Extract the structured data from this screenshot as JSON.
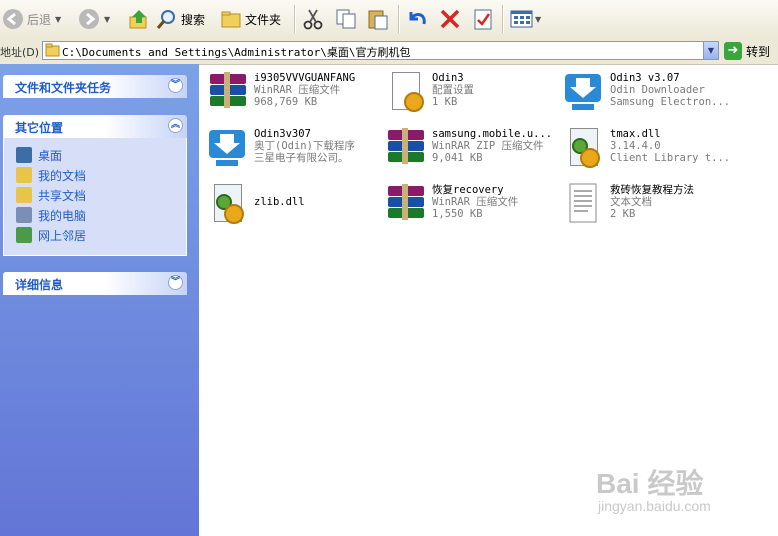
{
  "toolbar": {
    "back_label": "后退",
    "search_label": "搜索",
    "folders_label": "文件夹"
  },
  "address": {
    "label": "地址(D)",
    "path": "C:\\Documents and Settings\\Administrator\\桌面\\官方刷机包",
    "go_label": "转到"
  },
  "left_pane": {
    "tasks_title": "文件和文件夹任务",
    "other_places_title": "其它位置",
    "other_places": [
      {
        "label": "桌面",
        "icon": "desktop-icon",
        "color": "#3a6ea5"
      },
      {
        "label": "我的文档",
        "icon": "my-documents-icon",
        "color": "#e8c54a"
      },
      {
        "label": "共享文档",
        "icon": "shared-documents-icon",
        "color": "#e8c54a"
      },
      {
        "label": "我的电脑",
        "icon": "my-computer-icon",
        "color": "#7b8fb5"
      },
      {
        "label": "网上邻居",
        "icon": "network-places-icon",
        "color": "#4a9a4a"
      }
    ],
    "details_title": "详细信息"
  },
  "files": [
    {
      "name": "i9305VVVGUANFANG",
      "line2": "WinRAR 压缩文件",
      "line3": "968,769 KB",
      "icon": "winrar-archive-icon"
    },
    {
      "name": "Odin3",
      "line2": "配置设置",
      "line3": "1 KB",
      "icon": "config-settings-icon"
    },
    {
      "name": "Odin3 v3.07",
      "line2": "Odin Downloader",
      "line3": "Samsung Electron...",
      "icon": "odin-downloader-icon"
    },
    {
      "name": "Odin3v307",
      "line2": "奥丁(Odin)下载程序",
      "line3": "三星电子有限公司。",
      "icon": "odin-downloader-icon"
    },
    {
      "name": "samsung.mobile.u...",
      "line2": "WinRAR ZIP 压缩文件",
      "line3": "9,041 KB",
      "icon": "winrar-zip-icon"
    },
    {
      "name": "tmax.dll",
      "line2": "3.14.4.0",
      "line3": "Client Library t...",
      "icon": "dll-file-icon"
    },
    {
      "name": "zlib.dll",
      "line2": "",
      "line3": "",
      "icon": "dll-file-icon"
    },
    {
      "name": "恢复recovery",
      "line2": "WinRAR 压缩文件",
      "line3": "1,550 KB",
      "icon": "winrar-archive-icon"
    },
    {
      "name": "救砖恢复教程方法",
      "line2": "文本文档",
      "line3": "2 KB",
      "icon": "text-document-icon"
    }
  ],
  "watermark": {
    "brand": "Bai 经验",
    "url": "jingyan.baidu.com"
  }
}
